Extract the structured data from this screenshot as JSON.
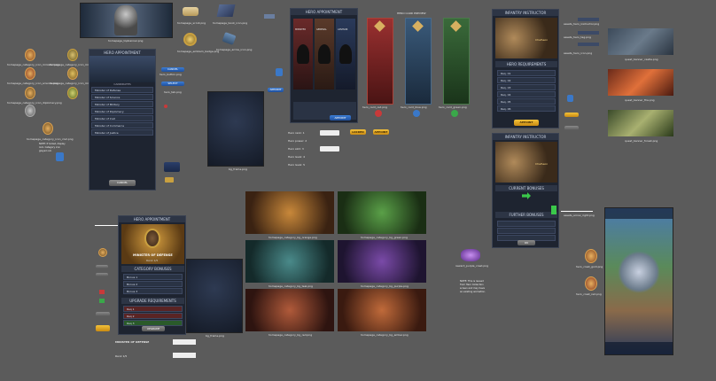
{
  "top_banner": {
    "label": "homepage_topbanner.png"
  },
  "top_assets": [
    {
      "name": "scroll_top",
      "label": "homepage_scroll.png"
    },
    {
      "name": "book",
      "label": "homepage_book_icon.png"
    },
    {
      "name": "emblem",
      "label": "homepage_emblem_badge.png"
    },
    {
      "name": "arrow",
      "label": "homepage_arrow_icon.png"
    }
  ],
  "crests_left": [
    "homepage_category_icon_minister.png",
    "homepage_category_icon_minister_defense.png",
    "homepage_category_icon_science.png",
    "homepage_category_icon_military.png",
    "homepage_category_icon_diplomacy.png",
    "homepage_category_icon_civil.png"
  ],
  "left_notes": {
    "lock": "NOTE: If locked, display lock. Category icon greyed out.",
    "frame": "hero_frame.png"
  },
  "hero_appointment": {
    "title": "HERO APPOINTMENT",
    "subtitle": "CANDIDATES",
    "rows": [
      "Minister of Defense",
      "Minister of Science",
      "Minister of Military",
      "Minister of Diplomacy",
      "Minister of Civil",
      "Minister of Commerce",
      "Minister of Justice"
    ],
    "button": "CANCEL",
    "side_labels": [
      "hero_button.png",
      "CANCEL",
      "SELECT",
      "hero_tab.png"
    ]
  },
  "bg_frame_label": "bg_frame.png",
  "hero_select_panel": {
    "title": "HERO APPOINTMENT",
    "columns": [
      "MINISTER",
      "GENERAL",
      "ADVISOR"
    ],
    "cta": "APPOINT",
    "info_rows": [
      "Hero rank: 1",
      "Hero power: 2",
      "Hero skill: 3",
      "Hero level: 4",
      "Hero level: 5"
    ],
    "buttons": [
      "LOCKED",
      "APPOINT"
    ]
  },
  "cards_title": "HERO CARD PREVIEW",
  "cards": [
    {
      "label": "hero_card_red.png",
      "color": "#8a2a2a"
    },
    {
      "label": "hero_card_blue.png",
      "color": "#2c4a66"
    },
    {
      "label": "hero_card_green.png",
      "color": "#2f5a34"
    }
  ],
  "infantry": {
    "title": "INFANTRY INSTRUCTOR",
    "name": "Chalheon",
    "section": "HERO REQUIREMENTS",
    "rows": [
      "Req. 01",
      "Req. 02",
      "Req. 03",
      "Req. 04",
      "Req. 05",
      "Req. 06",
      "Req. 07",
      "Req. 08"
    ],
    "button": "APPOINT",
    "side_notes": [
      "assets_hero_instructor.png",
      "assets_hero_tag.png",
      "assets_hero_icon.png"
    ]
  },
  "infantry2": {
    "title": "INFANTRY INSTRUCTOR",
    "name": "Chalheon",
    "section": "CURRENT BONUSES",
    "section2": "FURTHER BONUSES",
    "button": "OK",
    "note": "assets_arrow_right.png"
  },
  "scenes": [
    {
      "label": "quest_banner_castle.png"
    },
    {
      "label": "quest_banner_fire.png"
    },
    {
      "label": "quest_banner_forest.png"
    }
  ],
  "category_bgs": [
    {
      "label": "homepage_category_bg_orange.png",
      "color": "#8a5a22"
    },
    {
      "label": "homepage_category_bg_green.png",
      "color": "#2f5a2c"
    },
    {
      "label": "homepage_category_bg_teal.png",
      "color": "#2a5a5a"
    },
    {
      "label": "homepage_category_bg_purple.png",
      "color": "#4a2e66"
    },
    {
      "label": "homepage_category_bg_red.png",
      "color": "#6a2a22"
    },
    {
      "label": "homepage_category_bg_amber.png",
      "color": "#7a4a22"
    }
  ],
  "defense_panel": {
    "title": "HERO APPOINTMENT",
    "heading": "MINISTER OF DEFENSE",
    "sub": "Rank 1/5",
    "section1": "CATEGORY BONUSES",
    "section2": "UPGRADE REQUIREMENTS",
    "rows1": [
      "Bonus 1",
      "Bonus 2",
      "Bonus 3"
    ],
    "rows2": [
      "Req 1",
      "Req 2",
      "Req 3",
      "Req 4"
    ],
    "button": "UPGRADE",
    "footer": "MINISTER OF DEFENSE",
    "footer_sub": "Rank 1/5"
  },
  "bg_frame2_label": "bg_frame.png",
  "purple_note": {
    "label": "reward_purple_crest.png",
    "note": "NOTE: This is reused from Hero Collection screen and may have an existing animation."
  },
  "game_screen": {
    "label": "game_screenshot.png"
  },
  "right_crests": [
    "hero_crest_gold.png",
    "hero_crest_red.png"
  ]
}
